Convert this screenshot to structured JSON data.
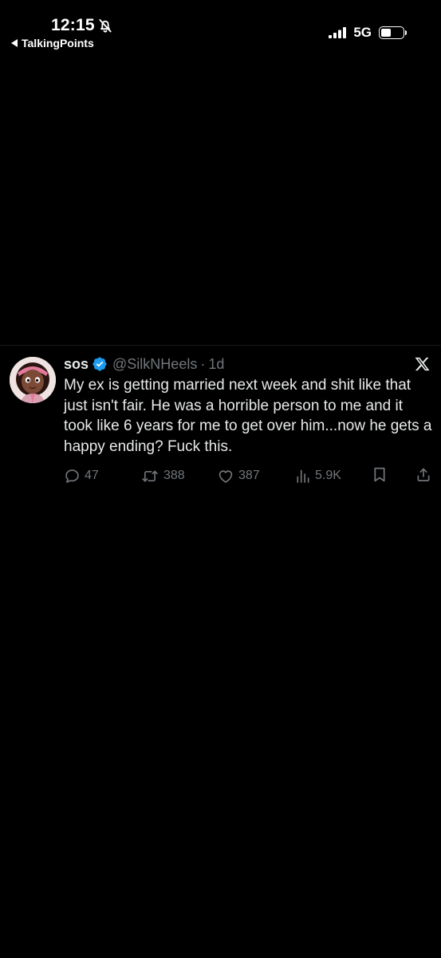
{
  "status_bar": {
    "time": "12:15",
    "back_app": "TalkingPoints",
    "network": "5G",
    "icons": [
      "bell-slash-icon",
      "signal-icon",
      "battery-icon"
    ]
  },
  "tweet": {
    "display_name": "sos",
    "handle": "@SilkNHeels",
    "separator": "·",
    "time": "1d",
    "text": "My ex is getting married next week and shit like that just isn't fair. He was a horrible person to me and it took like 6 years for me to get over him...now he gets a happy ending? Fuck this.",
    "verified_color": "#1d9bf0",
    "actions": {
      "replies": "47",
      "reposts": "388",
      "likes": "387",
      "views": "5.9K"
    }
  },
  "colors": {
    "background": "#000000",
    "text_primary": "#e7e9ea",
    "text_secondary": "#71767b",
    "accent": "#1d9bf0"
  }
}
